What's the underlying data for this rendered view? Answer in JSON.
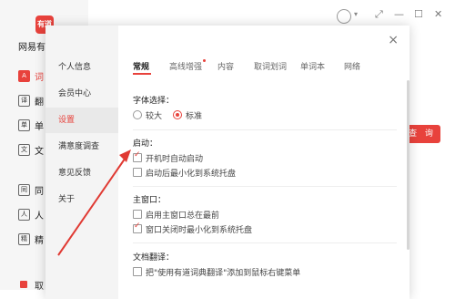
{
  "app": {
    "logo": "有道",
    "name": "网易有",
    "nav": [
      {
        "icon": "A",
        "label": "词",
        "active": true
      },
      {
        "icon": "译",
        "label": "翻"
      },
      {
        "icon": "单",
        "label": "单"
      },
      {
        "icon": "文",
        "label": "文"
      },
      {
        "icon": "同",
        "label": "同"
      },
      {
        "icon": "人",
        "label": "人"
      },
      {
        "icon": "精",
        "label": "精"
      }
    ],
    "query_label": "查 询",
    "bottom_label": "取"
  },
  "dialog": {
    "close": "×",
    "nav": [
      {
        "label": "个人信息"
      },
      {
        "label": "会员中心"
      },
      {
        "label": "设置",
        "active": true
      },
      {
        "label": "满意度调查"
      },
      {
        "label": "意见反馈"
      },
      {
        "label": "关于"
      }
    ],
    "tabs": [
      {
        "label": "常规",
        "active": true
      },
      {
        "label": "高线增强",
        "dot": true
      },
      {
        "label": "内容"
      },
      {
        "label": "取词划词"
      },
      {
        "label": "单词本"
      },
      {
        "label": "网络"
      }
    ],
    "font": {
      "title": "字体选择：",
      "options": [
        {
          "label": "较大",
          "checked": false
        },
        {
          "label": "标准",
          "checked": true
        }
      ]
    },
    "startup": {
      "title": "启动：",
      "options": [
        {
          "label": "开机时自动启动",
          "checked": true
        },
        {
          "label": "启动后最小化到系统托盘",
          "checked": false
        }
      ]
    },
    "main_window": {
      "title": "主窗口：",
      "options": [
        {
          "label": "启用主窗口总在最前",
          "checked": false
        },
        {
          "label": "窗口关闭时最小化到系统托盘",
          "checked": true
        }
      ]
    },
    "doc_translate": {
      "title": "文档翻译：",
      "options": [
        {
          "label": "把\"使用有道词典翻译\"添加到鼠标右键菜单",
          "checked": false
        }
      ]
    }
  },
  "colors": {
    "accent": "#e8423c",
    "arrow": "#e03a33"
  }
}
